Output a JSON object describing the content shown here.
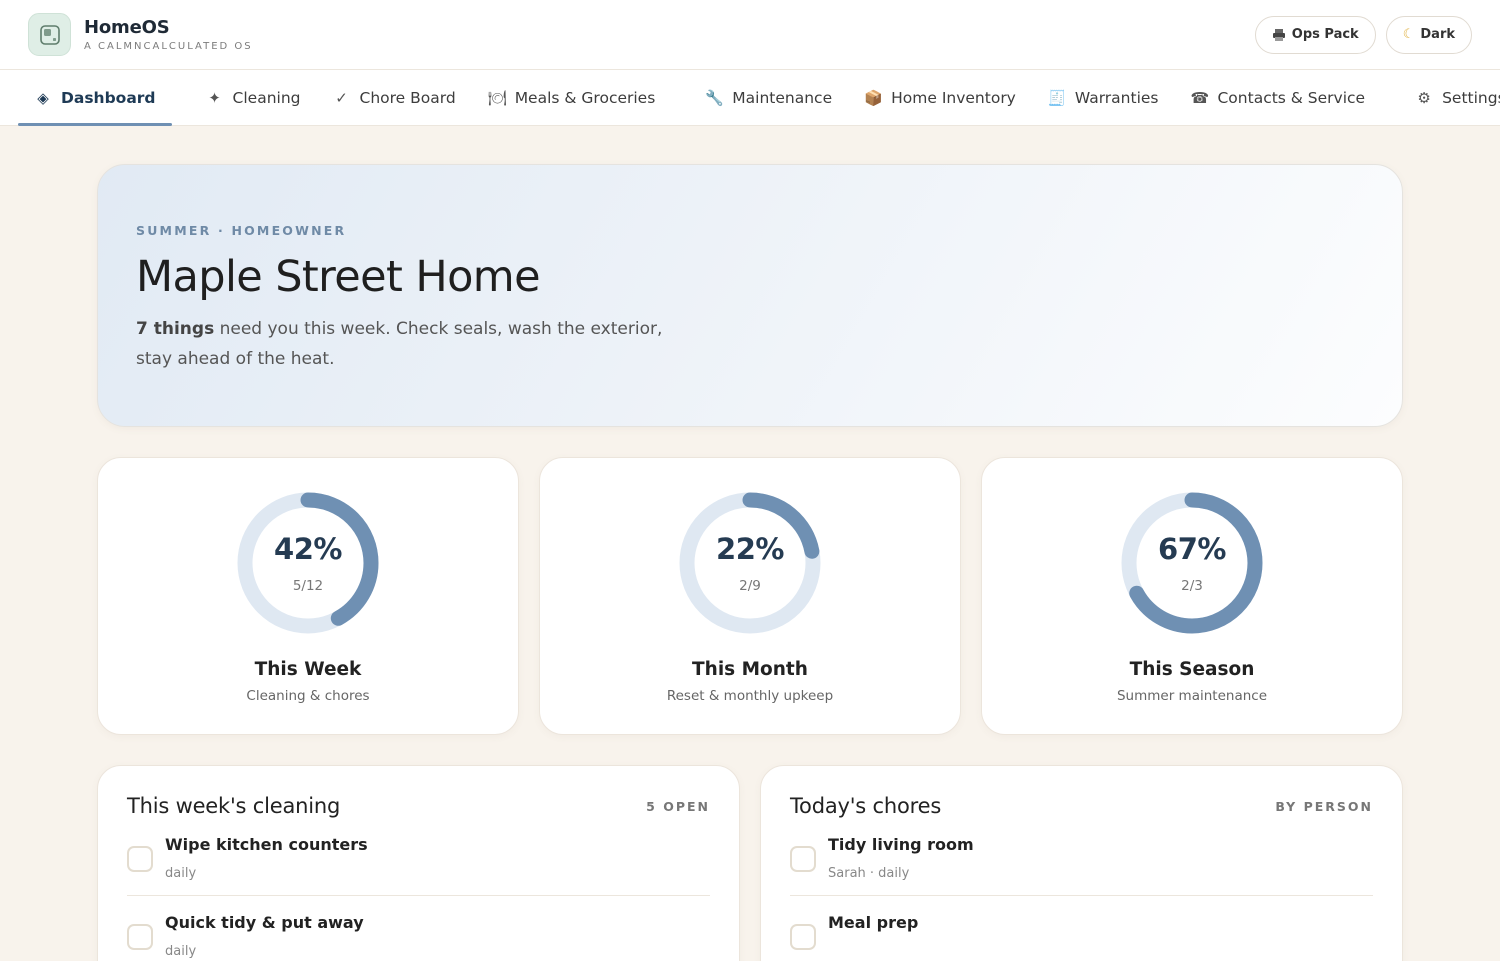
{
  "app": {
    "name": "HomeOS",
    "tagline": "A CALMNCALCULATED OS"
  },
  "top_actions": {
    "ops_pack": {
      "label": "Ops Pack",
      "icon": "printer-icon"
    },
    "dark": {
      "label": "Dark",
      "icon": "moon-icon"
    }
  },
  "nav": {
    "items": [
      {
        "label": "Dashboard",
        "icon": "◈",
        "active": true
      },
      {
        "label": "Cleaning",
        "icon": "✦"
      },
      {
        "label": "Chore Board",
        "icon": "✓"
      },
      {
        "label": "Meals & Groceries",
        "icon": "🍽"
      },
      {
        "label": "Maintenance",
        "icon": "🔧"
      },
      {
        "label": "Home Inventory",
        "icon": "📦"
      },
      {
        "label": "Warranties",
        "icon": "🧾"
      },
      {
        "label": "Contacts & Service",
        "icon": "☎"
      },
      {
        "label": "Settings",
        "icon": "⚙"
      }
    ]
  },
  "hero": {
    "eyebrow": "SUMMER · HOMEOWNER",
    "title": "Maple Street Home",
    "summary_bold": "7 things",
    "summary_rest": " need you this week. Check seals, wash the exterior, stay ahead of the heat."
  },
  "stats": [
    {
      "percent_label": "42%",
      "fraction": "5/12",
      "progress": 0.42,
      "title": "This Week",
      "subtitle": "Cleaning & chores"
    },
    {
      "percent_label": "22%",
      "fraction": "2/9",
      "progress": 0.22,
      "title": "This Month",
      "subtitle": "Reset & monthly upkeep"
    },
    {
      "percent_label": "67%",
      "fraction": "2/3",
      "progress": 0.67,
      "title": "This Season",
      "subtitle": "Summer maintenance"
    }
  ],
  "cleaning": {
    "title": "This week's cleaning",
    "badge": "5 OPEN",
    "tasks": [
      {
        "title": "Wipe kitchen counters",
        "meta": "daily"
      },
      {
        "title": "Quick tidy & put away",
        "meta": "daily"
      }
    ]
  },
  "chores": {
    "title": "Today's chores",
    "badge": "BY PERSON",
    "tasks": [
      {
        "title": "Tidy living room",
        "meta": "Sarah · daily"
      },
      {
        "title": "Meal prep",
        "meta": ""
      }
    ]
  },
  "colors": {
    "accent": "#6f90b3",
    "ring_track": "#dfe8f2",
    "background": "#f8f3ec"
  }
}
